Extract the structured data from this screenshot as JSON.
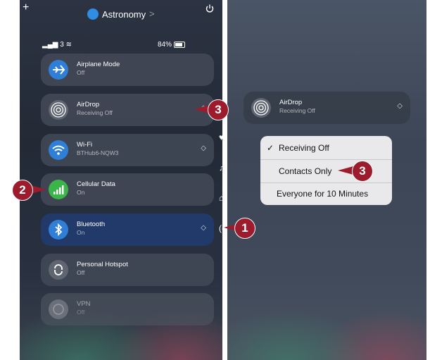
{
  "left": {
    "plus": "+",
    "location": "Astronomy",
    "location_chevron": ">",
    "signal": "3",
    "battery": "84%",
    "tiles": [
      {
        "title": "Airplane Mode",
        "subtitle": "Off"
      },
      {
        "title": "AirDrop",
        "subtitle": "Receiving Off"
      },
      {
        "title": "Wi-Fi",
        "subtitle": "BTHub6-NQW3"
      },
      {
        "title": "Cellular Data",
        "subtitle": "On"
      },
      {
        "title": "Bluetooth",
        "subtitle": "On"
      },
      {
        "title": "Personal Hotspot",
        "subtitle": "Off"
      },
      {
        "title": "VPN",
        "subtitle": "Off"
      }
    ],
    "chevron": "◇"
  },
  "right": {
    "tile": {
      "title": "AirDrop",
      "subtitle": "Receiving Off"
    },
    "menu": [
      {
        "label": "Receiving Off",
        "checked": "✓"
      },
      {
        "label": "Contacts Only"
      },
      {
        "label": "Everyone for 10 Minutes"
      }
    ]
  },
  "callouts": {
    "c1": "1",
    "c2": "2",
    "c3a": "3",
    "c3b": "3"
  },
  "colors": {
    "callout": "#9c1b2d",
    "airplane": "#2f7fd6",
    "cellular": "#3bb54a",
    "wifi": "#2f7fd6",
    "bluetooth": "#2f7fd6"
  }
}
